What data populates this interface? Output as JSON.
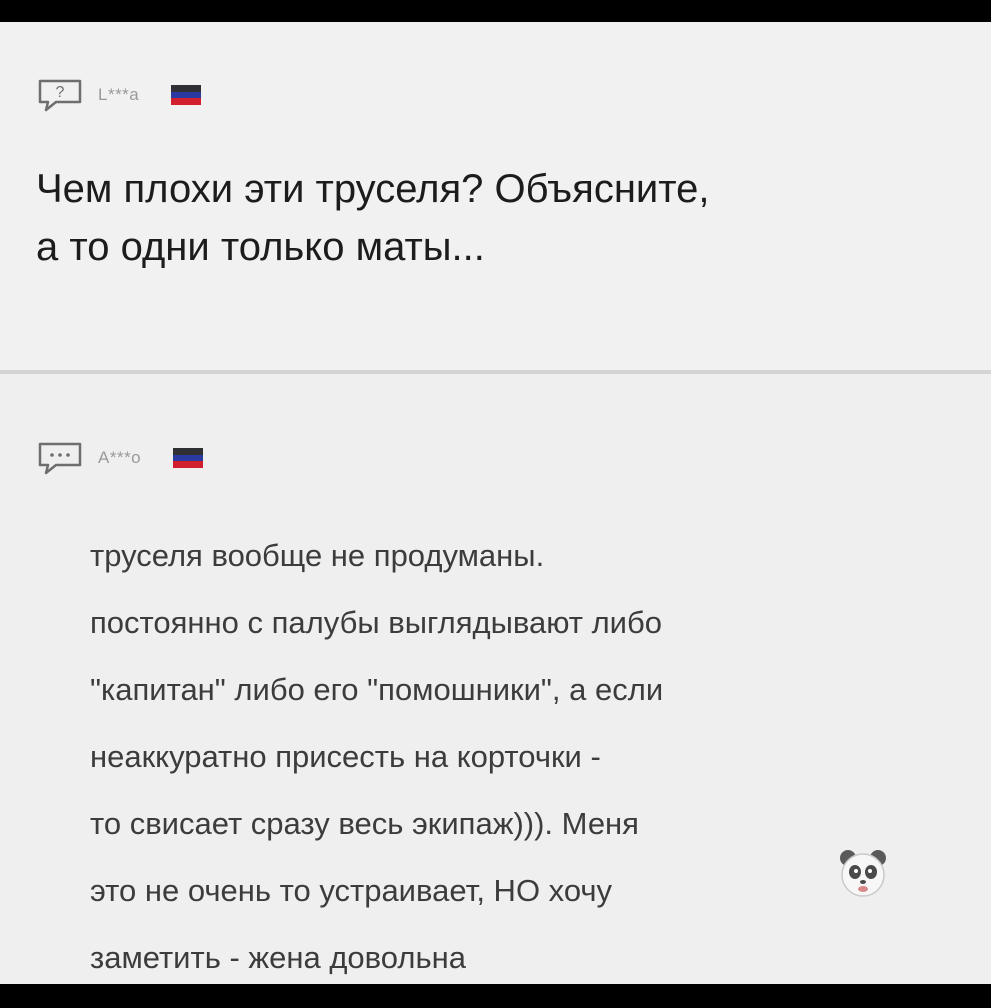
{
  "question": {
    "icon": "question-bubble-icon",
    "user": "L***a",
    "flag": "russia-flag-icon",
    "text": "Чем плохи эти труселя? Объясните,\nа то одни только маты..."
  },
  "answer": {
    "icon": "comment-bubble-icon",
    "user": "A***o",
    "flag": "russia-flag-icon",
    "text": "труселя вообще не продуманы.\nпостоянно с палубы выглядывают либо\n\"капитан\" либо его \"помошники\", а если\nнеаккуратно присесть на корточки -\nто свисает сразу весь экипаж))). Меня\nэто не очень то устраивает, НО хочу\nзаметить - жена довольна",
    "emoji": "panda-emoji-icon"
  },
  "colors": {
    "background": "#efefef",
    "question_text": "#1c1c1c",
    "answer_text": "#3c3c3c",
    "username": "#9a9a9a"
  }
}
